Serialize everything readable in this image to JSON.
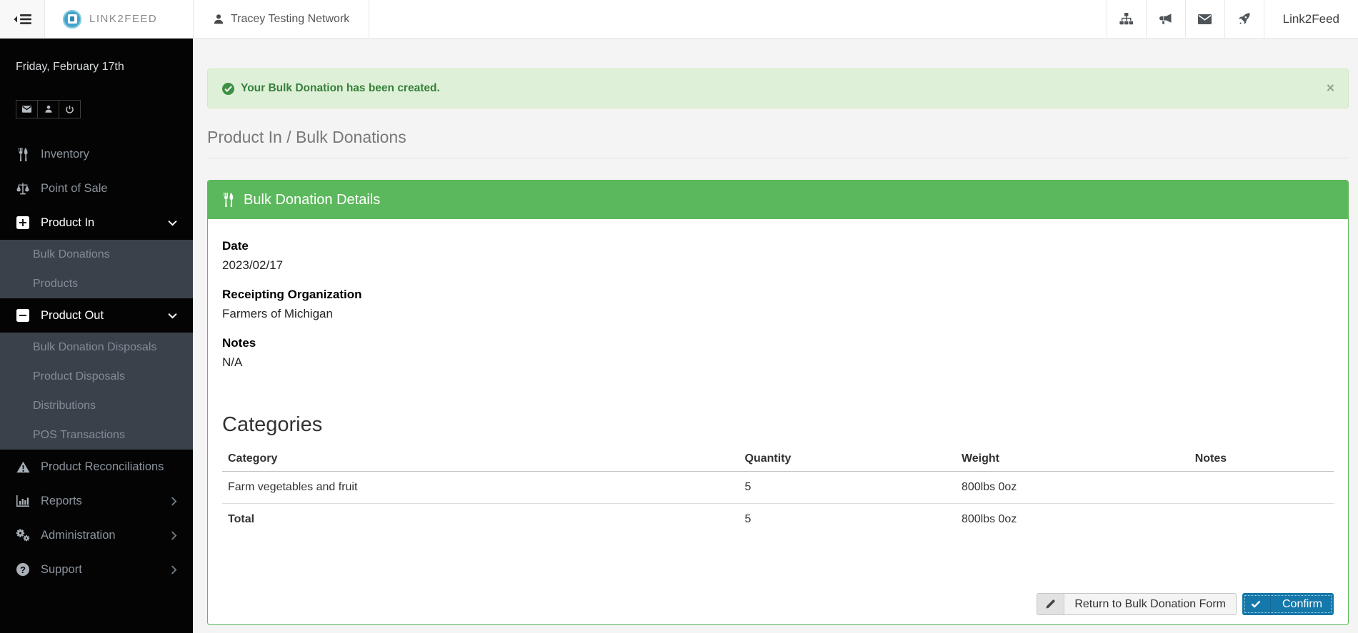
{
  "topbar": {
    "brand": "LINK2FEED",
    "network": "Tracey Testing Network",
    "right_label": "Link2Feed",
    "icons": [
      "sitemap-icon",
      "megaphone-icon",
      "mail-icon",
      "rocket-icon"
    ]
  },
  "sidebar": {
    "date": "Friday, February 17th",
    "quick_icons": [
      "mail-icon",
      "user-icon",
      "power-icon"
    ],
    "items": [
      {
        "label": "Inventory",
        "icon": "cutlery-icon"
      },
      {
        "label": "Point of Sale",
        "icon": "scale-icon"
      },
      {
        "label": "Product In",
        "icon": "plus-square-icon",
        "expanded": true,
        "children": [
          "Bulk Donations",
          "Products"
        ]
      },
      {
        "label": "Product Out",
        "icon": "minus-square-icon",
        "expanded": true,
        "children": [
          "Bulk Donation Disposals",
          "Product Disposals",
          "Distributions",
          "POS Transactions"
        ]
      },
      {
        "label": "Product Reconciliations",
        "icon": "warning-icon"
      },
      {
        "label": "Reports",
        "icon": "bar-chart-icon",
        "chevron": "right"
      },
      {
        "label": "Administration",
        "icon": "cogs-icon",
        "chevron": "right"
      },
      {
        "label": "Support",
        "icon": "question-icon",
        "chevron": "right"
      }
    ]
  },
  "alert": {
    "message": "Your Bulk Donation has been created.",
    "close": "×"
  },
  "breadcrumb": "Product In / Bulk Donations",
  "panel": {
    "title": "Bulk Donation Details",
    "fields": [
      {
        "label": "Date",
        "value": "2023/02/17"
      },
      {
        "label": "Receipting Organization",
        "value": "Farmers of Michigan"
      },
      {
        "label": "Notes",
        "value": "N/A"
      }
    ],
    "categories": {
      "heading": "Categories",
      "columns": [
        "Category",
        "Quantity",
        "Weight",
        "Notes"
      ],
      "rows": [
        {
          "category": "Farm vegetables and fruit",
          "quantity": "5",
          "weight": "800lbs 0oz",
          "notes": ""
        }
      ],
      "total": {
        "label": "Total",
        "quantity": "5",
        "weight": "800lbs 0oz",
        "notes": ""
      }
    }
  },
  "actions": {
    "return_label": "Return to Bulk Donation Form",
    "confirm_label": "Confirm"
  },
  "colors": {
    "accent_green": "#5cb85c",
    "alert_bg": "#dff0d8",
    "alert_text": "#35803a",
    "confirm_blue": "#1478aa",
    "sidebar_bg": "#040404",
    "submenu_bg": "#3a414a"
  }
}
